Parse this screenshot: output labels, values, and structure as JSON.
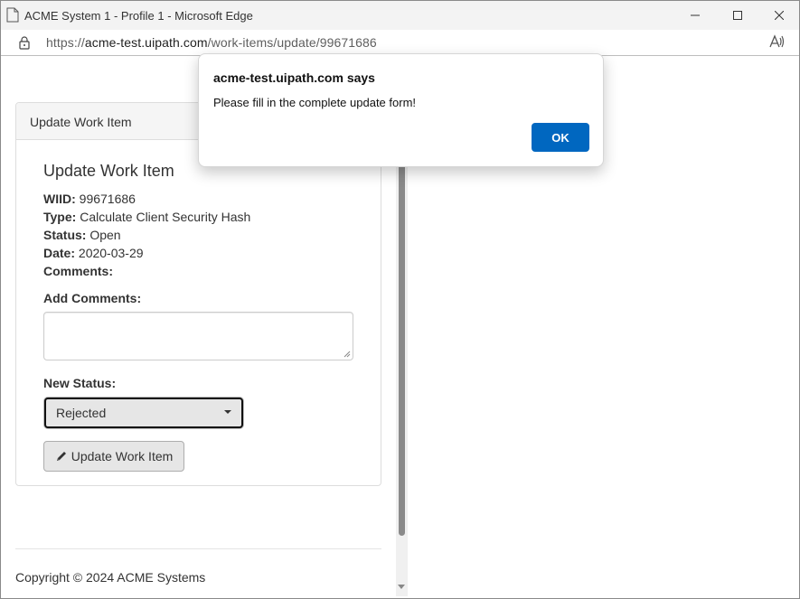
{
  "window": {
    "title": "ACME System 1 - Profile 1 - Microsoft Edge"
  },
  "address_bar": {
    "url_prefix": "https://",
    "url_host": "acme-test.uipath.com",
    "url_path": "/work-items/update/99671686"
  },
  "panel": {
    "heading": "Update Work Item",
    "title": "Update Work Item",
    "fields": {
      "wiid_label": "WIID:",
      "wiid_value": "99671686",
      "type_label": "Type:",
      "type_value": "Calculate Client Security Hash",
      "status_label": "Status:",
      "status_value": "Open",
      "date_label": "Date:",
      "date_value": "2020-03-29",
      "comments_label": "Comments:"
    },
    "add_comments_label": "Add Comments:",
    "add_comments_value": "",
    "new_status_label": "New Status:",
    "new_status_value": "Rejected",
    "submit_label": "Update Work Item"
  },
  "footer": {
    "text": "Copyright © 2024 ACME Systems"
  },
  "dialog": {
    "title": "acme-test.uipath.com says",
    "message": "Please fill in the complete update form!",
    "ok_label": "OK"
  },
  "colors": {
    "accent": "#0067c0",
    "titlebar": "#f3f3f3"
  }
}
